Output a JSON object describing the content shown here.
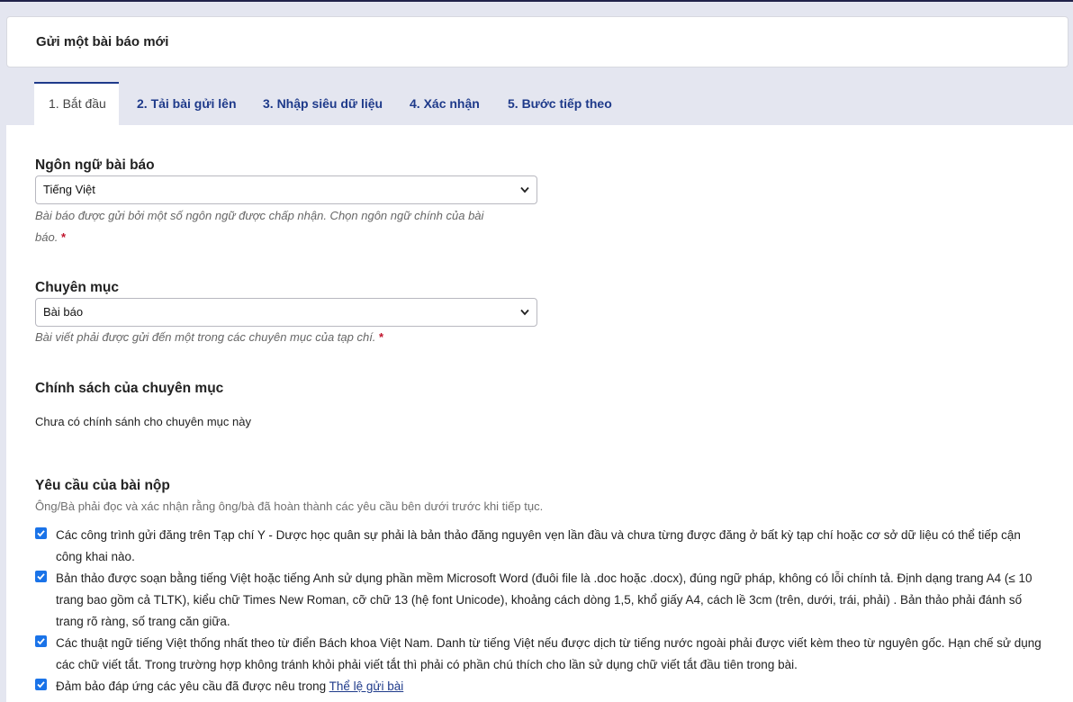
{
  "page": {
    "title": "Gửi một bài báo mới"
  },
  "tabs": [
    {
      "label": "1. Bắt đầu"
    },
    {
      "label": "2. Tải bài gửi lên"
    },
    {
      "label": "3. Nhập siêu dữ liệu"
    },
    {
      "label": "4. Xác nhận"
    },
    {
      "label": "5. Bước tiếp theo"
    }
  ],
  "form": {
    "language": {
      "label": "Ngôn ngữ bài báo",
      "value": "Tiếng Việt",
      "help_line1": "Bài báo được gửi bởi một số ngôn ngữ được chấp nhận. Chọn ngôn ngữ chính của bài",
      "help_line2": "báo.",
      "required_mark": "*"
    },
    "section": {
      "label": "Chuyên mục",
      "value": "Bài báo",
      "help": "Bài viết phải được gửi đến một trong các chuyên mục của tạp chí.",
      "required_mark": "*"
    },
    "section_policy": {
      "label": "Chính sách của chuyên mục",
      "text": "Chưa có chính sánh cho chuyên mục này"
    },
    "requirements": {
      "label": "Yêu cầu của bài nộp",
      "note": "Ông/Bà phải đọc và xác nhận rằng ông/bà đã hoàn thành các yêu cầu bên dưới trước khi tiếp tục.",
      "items": [
        {
          "text": "Các công trình gửi đăng trên Tạp chí Y - Dược học quân sự phải là bản thảo đăng nguyên vẹn lần đầu và chưa từng được đăng ở bất kỳ tạp chí hoặc cơ sở dữ liệu có thể tiếp cận công khai nào.",
          "checked": true
        },
        {
          "text": "Bản thảo được soạn bằng tiếng Việt hoặc tiếng Anh sử dụng phần mềm Microsoft Word (đuôi file là .doc hoặc .docx), đúng ngữ pháp, không có lỗi chính tả. Định dạng trang A4 (≤ 10 trang bao gồm cả TLTK), kiểu chữ  Times New Roman, cỡ chữ  13 (hệ font Unicode), khoảng cách dòng 1,5, khổ giấy A4, cách lề 3cm (trên, dưới, trái, phải) . Bản thảo phải đánh số trang rõ ràng, số trang căn giữa.",
          "checked": true
        },
        {
          "text": "Các thuật ngữ tiếng Việt thống nhất theo từ điển Bách khoa Việt Nam. Danh từ tiếng Việt nếu được dịch từ tiếng nước ngoài phải được viết kèm theo từ nguyên gốc. Hạn chế sử dụng các chữ viết tắt. Trong trường hợp không tránh khỏi phải viết tắt thì phải có phần chú thích cho lần sử dụng chữ viết tắt đầu tiên trong bài.",
          "checked": true
        },
        {
          "text": "Đảm bảo đáp ứng các yêu cầu đã được nêu trong",
          "link": "Thể lệ gửi bài",
          "checked": true
        }
      ]
    }
  },
  "colors": {
    "accent": "#1e3a8a",
    "checkbox": "#1a73e8",
    "required": "#c0142c"
  }
}
